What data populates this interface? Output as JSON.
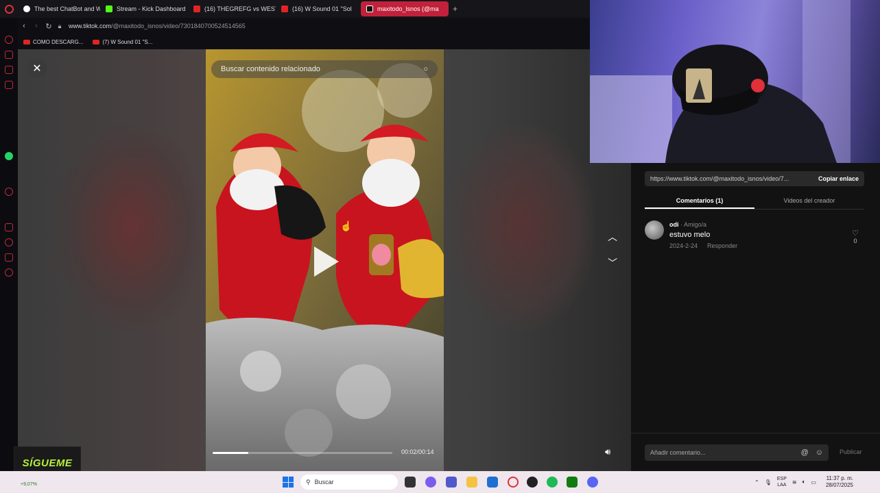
{
  "browser": {
    "tabs": [
      {
        "label": "The best ChatBot and Wri",
        "color": "#ffffff"
      },
      {
        "label": "Stream - Kick Dashboard",
        "color": "#53fc18"
      },
      {
        "label": "(16) THEGREFG vs WEST",
        "color": "#e02424"
      },
      {
        "label": "(16) W Sound 01 \"Sol",
        "color": "#e02424"
      },
      {
        "label": "maxitodo_lsnos (@ma",
        "color": "#ffffff"
      }
    ],
    "new_tab": "+",
    "url_host": "www.tiktok.com",
    "url_path": "/@maxitodo_isnos/video/7301840700524514565",
    "bookmarks": [
      "COMO DESCARG...",
      "(7) W Sound 01 \"S..."
    ]
  },
  "video": {
    "search_placeholder": "Buscar contenido relacionado",
    "progress": 0.2,
    "time": "00:02/00:14"
  },
  "panel": {
    "share_url": "https://www.tiktok.com/@maxitodo_isnos/video/7...",
    "copy_link": "Copiar enlace",
    "tabs": [
      "Comentarios (1)",
      "Videos del creador"
    ],
    "comments": [
      {
        "user": "odi",
        "relation": " · Amigo/a",
        "text": "estuvo melo",
        "date": "2024-2-24",
        "reply": "Responder",
        "likes": "0"
      }
    ],
    "comment_placeholder": "Añadir comentario...",
    "publish": "Publicar"
  },
  "overlay": {
    "follow_badge": "SÍGUEME"
  },
  "taskbar": {
    "stock": "+9,07%",
    "search": "Buscar",
    "lang_top": "ESP",
    "lang_bottom": "LAA",
    "time": "11:37 p. m.",
    "date": "28/07/2025"
  }
}
